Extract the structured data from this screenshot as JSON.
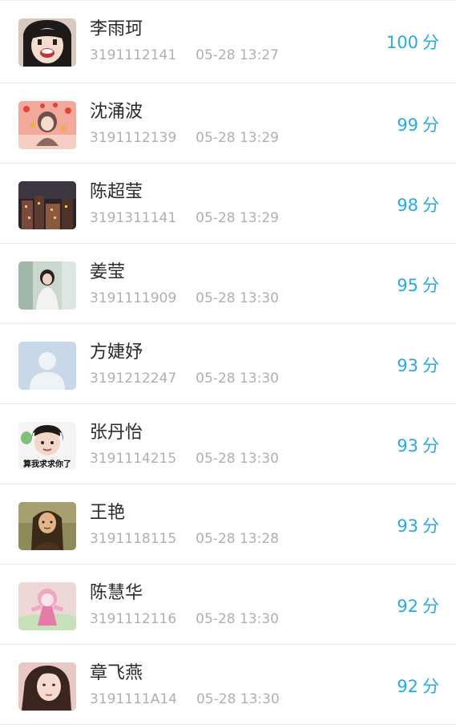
{
  "accent_color": "#29a9e6",
  "unit": "分",
  "students": [
    {
      "name": "李雨珂",
      "id": "3191112141",
      "time": "05-28 13:27",
      "score": "100",
      "avatar": "anime-girl-avatar"
    },
    {
      "name": "沈涌波",
      "id": "3191112139",
      "time": "05-28 13:29",
      "score": "99",
      "avatar": "cartoon-hearts-avatar"
    },
    {
      "name": "陈超莹",
      "id": "3191311141",
      "time": "05-28 13:29",
      "score": "98",
      "avatar": "night-town-avatar"
    },
    {
      "name": "姜莹",
      "id": "3191111909",
      "time": "05-28 13:30",
      "score": "95",
      "avatar": "girl-photo-avatar"
    },
    {
      "name": "方婕妤",
      "id": "3191212247",
      "time": "05-28 13:30",
      "score": "93",
      "avatar": "default-user-avatar"
    },
    {
      "name": "张丹怡",
      "id": "3191114215",
      "time": "05-28 13:30",
      "score": "93",
      "avatar": "meme-boy-avatar",
      "avatar_caption": "算我求求你了"
    },
    {
      "name": "王艳",
      "id": "3191118115",
      "time": "05-28 13:28",
      "score": "93",
      "avatar": "mona-lisa-avatar"
    },
    {
      "name": "陈慧华",
      "id": "3191112116",
      "time": "05-28 13:30",
      "score": "92",
      "avatar": "pink-cartoon-avatar"
    },
    {
      "name": "章飞燕",
      "id": "3191111A14",
      "time": "05-28 13:30",
      "score": "92",
      "avatar": "woman-portrait-avatar"
    }
  ]
}
